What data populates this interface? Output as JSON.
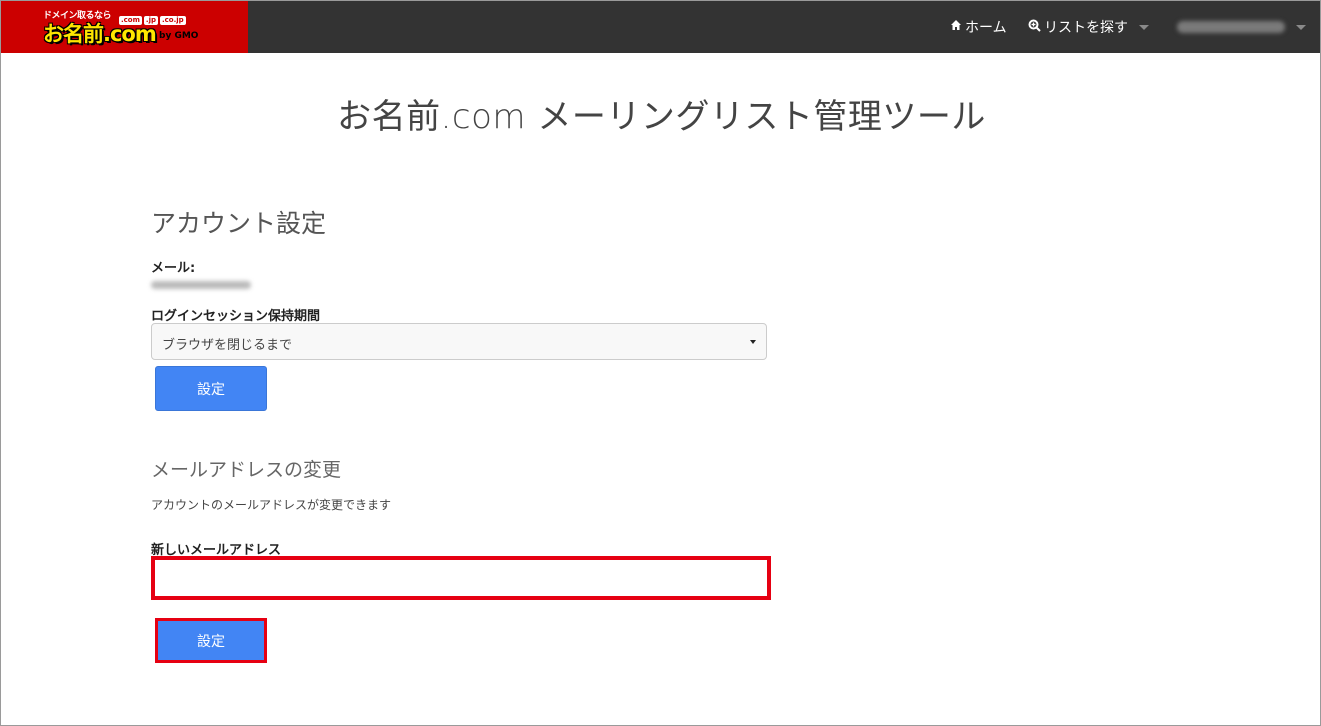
{
  "header": {
    "logo": {
      "tagline": "ドメイン取るなら",
      "brand": "お名前.com",
      "tlds": [
        ".com",
        ".jp",
        ".co.jp"
      ],
      "by": "by GMO"
    },
    "nav": {
      "home": "ホーム",
      "search_list": "リストを探す"
    }
  },
  "page": {
    "title": "お名前.com メーリングリスト管理ツール"
  },
  "account": {
    "title": "アカウント設定",
    "email_label": "メール:",
    "session_label": "ログインセッション保持期間",
    "session_value": "ブラウザを閉じるまで",
    "submit_label": "設定"
  },
  "email_change": {
    "title": "メールアドレスの変更",
    "description": "アカウントのメールアドレスが変更できます",
    "new_email_label": "新しいメールアドレス",
    "new_email_value": "",
    "submit_label": "設定"
  },
  "colors": {
    "navbar": "#333333",
    "logo_bg": "#cc0000",
    "button": "#4285f4",
    "highlight": "#e60012"
  },
  "icons": {
    "home": "home-icon",
    "search": "search-icon"
  }
}
